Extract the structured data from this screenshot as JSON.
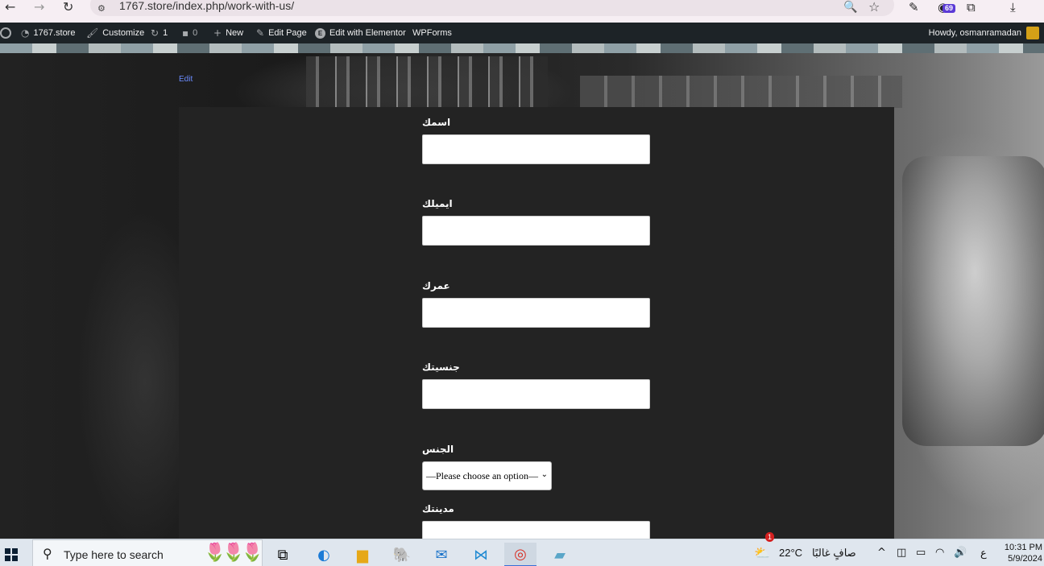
{
  "browser": {
    "url": "1767.store/index.php/work-with-us/",
    "extension_badge": "69"
  },
  "wp_admin_bar": {
    "site_name": "1767.store",
    "customize": "Customize",
    "updates_count": "1",
    "comments_count": "0",
    "new_label": "New",
    "edit_page": "Edit Page",
    "edit_with_elementor": "Edit with Elementor",
    "wpforms": "WPForms",
    "howdy": "Howdy, osmanramadan"
  },
  "page": {
    "edit_link": "Edit"
  },
  "form": {
    "fields": [
      {
        "label": "اسمك",
        "type": "text",
        "value": ""
      },
      {
        "label": "ايميلك",
        "type": "text",
        "value": ""
      },
      {
        "label": "عمرك",
        "type": "text",
        "value": ""
      },
      {
        "label": "جنسيتك",
        "type": "text",
        "value": ""
      },
      {
        "label": "الجنس",
        "type": "select",
        "value": "—Please choose an option—"
      },
      {
        "label": "مدينتك",
        "type": "text",
        "value": ""
      }
    ]
  },
  "taskbar": {
    "search_placeholder": "Type here to search",
    "weather_temp": "22°C",
    "weather_desc": "صافٍ غالبًا",
    "weather_badge": "1",
    "input_lang": "ع",
    "time": "10:31 PM",
    "date": "5/9/2024"
  },
  "colors": {
    "wp_bar": "#1d2327",
    "content_bg": "#232323",
    "taskbar": "#dfe6ee"
  }
}
